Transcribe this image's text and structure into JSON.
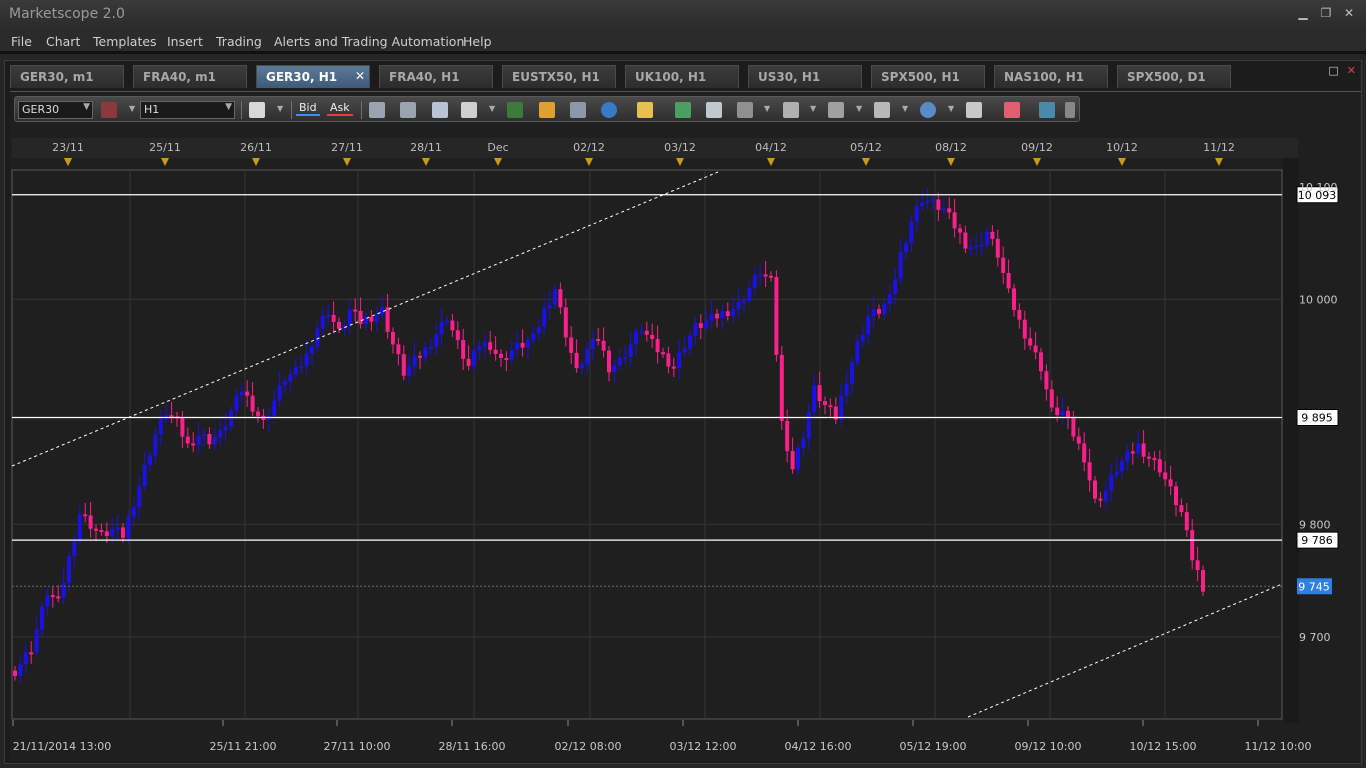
{
  "app": {
    "title": "Marketscope 2.0"
  },
  "window_controls": {
    "minimize": "▁",
    "restore": "❐",
    "close": "✕"
  },
  "menu": [
    "File",
    "Chart",
    "Templates",
    "Insert",
    "Trading",
    "Alerts and Trading Automation",
    "Help"
  ],
  "tabs": [
    {
      "label": "GER30, m1",
      "active": false
    },
    {
      "label": "FRA40, m1",
      "active": false
    },
    {
      "label": "GER30, H1",
      "active": true
    },
    {
      "label": "FRA40, H1",
      "active": false
    },
    {
      "label": "EUSTX50, H1",
      "active": false
    },
    {
      "label": "UK100, H1",
      "active": false
    },
    {
      "label": "US30, H1",
      "active": false
    },
    {
      "label": "SPX500, H1",
      "active": false
    },
    {
      "label": "NAS100, H1",
      "active": false
    },
    {
      "label": "SPX500, D1",
      "active": false
    }
  ],
  "tab_close": "✕",
  "frame_controls": {
    "maximize": "□",
    "close": "✕"
  },
  "toolbar": {
    "instrument": "GER30",
    "timeframe": "H1",
    "bid_label": "Bid",
    "ask_label": "Ask",
    "icons": [
      "chart-type-icon",
      "link-icon",
      "zoom-in-icon",
      "zoom-out-icon",
      "cursor-icon",
      "crosshair-icon",
      "indicator-icon",
      "note-icon",
      "refresh-icon",
      "globe-icon",
      "ruler-icon",
      "image-icon",
      "window-icon",
      "fibonacci-icon",
      "channel-icon",
      "pen-icon",
      "line-icon",
      "ellipse-icon",
      "text-icon",
      "eraser-icon",
      "tree-icon",
      "more-icon"
    ]
  },
  "chart_data": {
    "type": "candlestick",
    "symbol": "GER30",
    "timeframe": "H1",
    "colors": {
      "up": "#1a10e8",
      "down": "#ff1f8a",
      "background": "#1f1f1f",
      "grid": "#353535",
      "marker": "#c89b1a",
      "price_highlight": "#2f7fe0"
    },
    "top_dates": [
      "23/11",
      "25/11",
      "26/11",
      "27/11",
      "28/11",
      "Dec",
      "02/12",
      "03/12",
      "04/12",
      "05/12",
      "08/12",
      "09/12",
      "10/12",
      "11/12"
    ],
    "bottom_labels": [
      "21/11/2014 13:00",
      "25/11 21:00",
      "27/11 10:00",
      "28/11 16:00",
      "02/12 08:00",
      "03/12 12:00",
      "04/12 16:00",
      "05/12 19:00",
      "09/12 10:00",
      "10/12 15:00",
      "11/12 10:00"
    ],
    "y_ticks": [
      "10 000",
      "9 800",
      "9 700"
    ],
    "y_tick_values": [
      10000,
      9800,
      9700
    ],
    "ylim": [
      9627,
      10115
    ],
    "partial_top_label": "10 100",
    "horizontal_lines": [
      {
        "label": "10 093",
        "value": 10093
      },
      {
        "label": "9 895",
        "value": 9895
      },
      {
        "label": "9 786",
        "value": 9786
      }
    ],
    "current_price": {
      "label": "9 745",
      "value": 9745
    },
    "trendlines": [
      "upper-channel-line",
      "lower-channel-line"
    ],
    "close_path": [
      [
        0,
        9670
      ],
      [
        3,
        9690
      ],
      [
        6,
        9740
      ],
      [
        8,
        9730
      ],
      [
        10,
        9770
      ],
      [
        12,
        9810
      ],
      [
        14,
        9800
      ],
      [
        16,
        9790
      ],
      [
        18,
        9795
      ],
      [
        20,
        9790
      ],
      [
        22,
        9820
      ],
      [
        24,
        9850
      ],
      [
        26,
        9880
      ],
      [
        28,
        9900
      ],
      [
        30,
        9890
      ],
      [
        32,
        9870
      ],
      [
        34,
        9880
      ],
      [
        36,
        9875
      ],
      [
        38,
        9880
      ],
      [
        40,
        9900
      ],
      [
        42,
        9920
      ],
      [
        44,
        9905
      ],
      [
        46,
        9890
      ],
      [
        48,
        9910
      ],
      [
        50,
        9930
      ],
      [
        52,
        9935
      ],
      [
        54,
        9950
      ],
      [
        56,
        9975
      ],
      [
        58,
        9990
      ],
      [
        60,
        9970
      ],
      [
        62,
        9990
      ],
      [
        64,
        9980
      ],
      [
        66,
        9985
      ],
      [
        68,
        9990
      ],
      [
        70,
        9960
      ],
      [
        72,
        9935
      ],
      [
        74,
        9945
      ],
      [
        76,
        9955
      ],
      [
        78,
        9970
      ],
      [
        80,
        9985
      ],
      [
        82,
        9960
      ],
      [
        84,
        9940
      ],
      [
        86,
        9960
      ],
      [
        88,
        9960
      ],
      [
        90,
        9945
      ],
      [
        92,
        9955
      ],
      [
        94,
        9960
      ],
      [
        96,
        9965
      ],
      [
        98,
        9990
      ],
      [
        100,
        10010
      ],
      [
        102,
        9970
      ],
      [
        104,
        9935
      ],
      [
        106,
        9955
      ],
      [
        108,
        9965
      ],
      [
        110,
        9940
      ],
      [
        112,
        9945
      ],
      [
        114,
        9960
      ],
      [
        116,
        9975
      ],
      [
        118,
        9960
      ],
      [
        120,
        9950
      ],
      [
        122,
        9940
      ],
      [
        124,
        9960
      ],
      [
        126,
        9975
      ],
      [
        128,
        9980
      ],
      [
        130,
        9985
      ],
      [
        132,
        9990
      ],
      [
        134,
        9995
      ],
      [
        136,
        10010
      ],
      [
        138,
        10025
      ],
      [
        140,
        10015
      ],
      [
        142,
        9890
      ],
      [
        144,
        9850
      ],
      [
        146,
        9880
      ],
      [
        148,
        9920
      ],
      [
        150,
        9905
      ],
      [
        152,
        9895
      ],
      [
        154,
        9930
      ],
      [
        156,
        9960
      ],
      [
        158,
        9985
      ],
      [
        160,
        9990
      ],
      [
        162,
        10000
      ],
      [
        164,
        10040
      ],
      [
        166,
        10070
      ],
      [
        168,
        10090
      ],
      [
        170,
        10085
      ],
      [
        172,
        10080
      ],
      [
        174,
        10065
      ],
      [
        176,
        10050
      ],
      [
        178,
        10045
      ],
      [
        180,
        10060
      ],
      [
        182,
        10040
      ],
      [
        184,
        10005
      ],
      [
        186,
        9980
      ],
      [
        188,
        9960
      ],
      [
        190,
        9940
      ],
      [
        192,
        9900
      ],
      [
        194,
        9900
      ],
      [
        196,
        9880
      ],
      [
        198,
        9860
      ],
      [
        200,
        9820
      ],
      [
        202,
        9830
      ],
      [
        204,
        9850
      ],
      [
        206,
        9860
      ],
      [
        208,
        9870
      ],
      [
        210,
        9860
      ],
      [
        212,
        9850
      ],
      [
        214,
        9830
      ],
      [
        216,
        9810
      ],
      [
        218,
        9770
      ],
      [
        220,
        9745
      ]
    ]
  }
}
